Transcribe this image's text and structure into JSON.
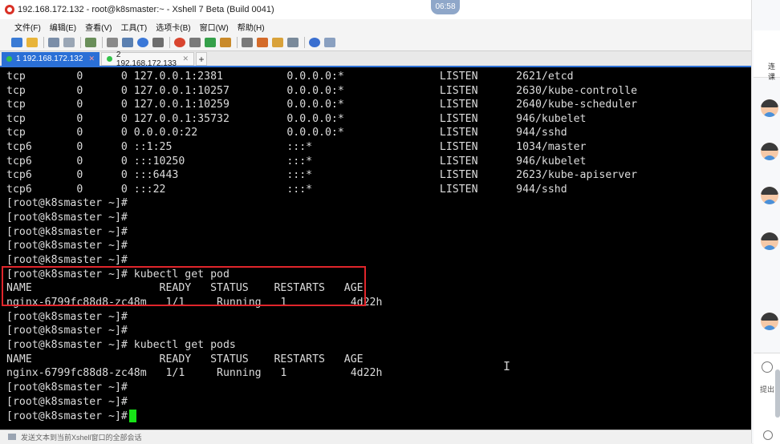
{
  "window": {
    "title": "192.168.172.132 - root@k8smaster:~ - Xshell 7 Beta (Build 0041)",
    "clock": "06:58"
  },
  "menu": [
    "文件(F)",
    "编辑(E)",
    "查看(V)",
    "工具(T)",
    "选项卡(B)",
    "窗口(W)",
    "帮助(H)"
  ],
  "toolbar_icons": [
    {
      "name": "new-session-icon",
      "color": "#3a7bd5"
    },
    {
      "name": "open-folder-icon",
      "color": "#e8b43a"
    },
    {
      "name": "connect-icon",
      "color": "#7b8ea8"
    },
    {
      "name": "disconnect-icon",
      "color": "#9aa6b5"
    },
    {
      "name": "reconnect-icon",
      "color": "#6a8f5a"
    },
    {
      "name": "find-icon",
      "color": "#8a8a8a"
    },
    {
      "name": "properties-icon",
      "color": "#5a7fb0"
    },
    {
      "name": "color-scheme-icon",
      "color": "#3b78d8"
    },
    {
      "name": "font-icon",
      "color": "#6e6e6e"
    },
    {
      "name": "xftp-icon",
      "color": "#d9452f"
    },
    {
      "name": "xagent-icon",
      "color": "#7a7a7a"
    },
    {
      "name": "fullscreen-icon",
      "color": "#35a04a"
    },
    {
      "name": "lock-icon",
      "color": "#c98a2a"
    },
    {
      "name": "keyboard-icon",
      "color": "#7a7a7a"
    },
    {
      "name": "script-icon",
      "color": "#d46b2a"
    },
    {
      "name": "tunnel-icon",
      "color": "#d9a23a"
    },
    {
      "name": "layout-icon",
      "color": "#7a8a9a"
    },
    {
      "name": "help-icon",
      "color": "#3a6fd0"
    },
    {
      "name": "chat-icon",
      "color": "#8aa0c0"
    }
  ],
  "tabs": [
    {
      "label": "1 192.168.172.132",
      "active": true
    },
    {
      "label": "2 192.168.172.133",
      "active": false
    }
  ],
  "terminal": {
    "lines": [
      "tcp        0      0 127.0.0.1:2381          0.0.0.0:*               LISTEN      2621/etcd",
      "tcp        0      0 127.0.0.1:10257         0.0.0.0:*               LISTEN      2630/kube-controlle",
      "tcp        0      0 127.0.0.1:10259         0.0.0.0:*               LISTEN      2640/kube-scheduler",
      "tcp        0      0 127.0.0.1:35732         0.0.0.0:*               LISTEN      946/kubelet",
      "tcp        0      0 0.0.0.0:22              0.0.0.0:*               LISTEN      944/sshd",
      "tcp6       0      0 ::1:25                  :::*                    LISTEN      1034/master",
      "tcp6       0      0 :::10250                :::*                    LISTEN      946/kubelet",
      "tcp6       0      0 :::6443                 :::*                    LISTEN      2623/kube-apiserver",
      "tcp6       0      0 :::22                   :::*                    LISTEN      944/sshd",
      "[root@k8smaster ~]#",
      "[root@k8smaster ~]#",
      "[root@k8smaster ~]#",
      "[root@k8smaster ~]#",
      "[root@k8smaster ~]#",
      "[root@k8smaster ~]# kubectl get pod",
      "NAME                    READY   STATUS    RESTARTS   AGE",
      "nginx-6799fc88d8-zc48m   1/1     Running   1          4d22h",
      "[root@k8smaster ~]#",
      "[root@k8smaster ~]#",
      "[root@k8smaster ~]# kubectl get pods",
      "NAME                    READY   STATUS    RESTARTS   AGE",
      "nginx-6799fc88d8-zc48m   1/1     Running   1          4d22h",
      "[root@k8smaster ~]#",
      "[root@k8smaster ~]#",
      "[root@k8smaster ~]#"
    ],
    "cursor_color": "#17e317",
    "highlight_color": "#e0252b"
  },
  "status_bar": {
    "text": "发送文本到当前Xshell窗口的全部会话"
  },
  "side_panel": {
    "header_text": "连课",
    "footer_hint": "提出"
  }
}
